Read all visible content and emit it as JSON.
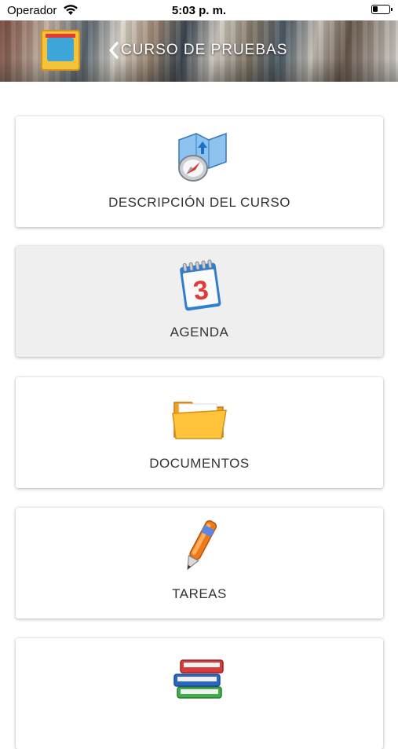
{
  "status_bar": {
    "carrier": "Operador",
    "time": "5:03 p. m."
  },
  "header": {
    "title": "CURSO DE PRUEBAS",
    "back_icon": "chevron-left-icon",
    "logo": "school-logo"
  },
  "menu": {
    "items": [
      {
        "label": "DESCRIPCIÓN DEL CURSO",
        "icon": "compass-map-icon"
      },
      {
        "label": "AGENDA",
        "icon": "calendar-icon",
        "calendar_day": "3"
      },
      {
        "label": "DOCUMENTOS",
        "icon": "folder-icon"
      },
      {
        "label": "TAREAS",
        "icon": "pencil-icon"
      },
      {
        "label": "",
        "icon": "books-icon"
      }
    ],
    "selected_index": 1
  },
  "colors": {
    "card_selected_bg": "#efefef",
    "card_bg": "#ffffff",
    "title_text": "#ffffff"
  }
}
